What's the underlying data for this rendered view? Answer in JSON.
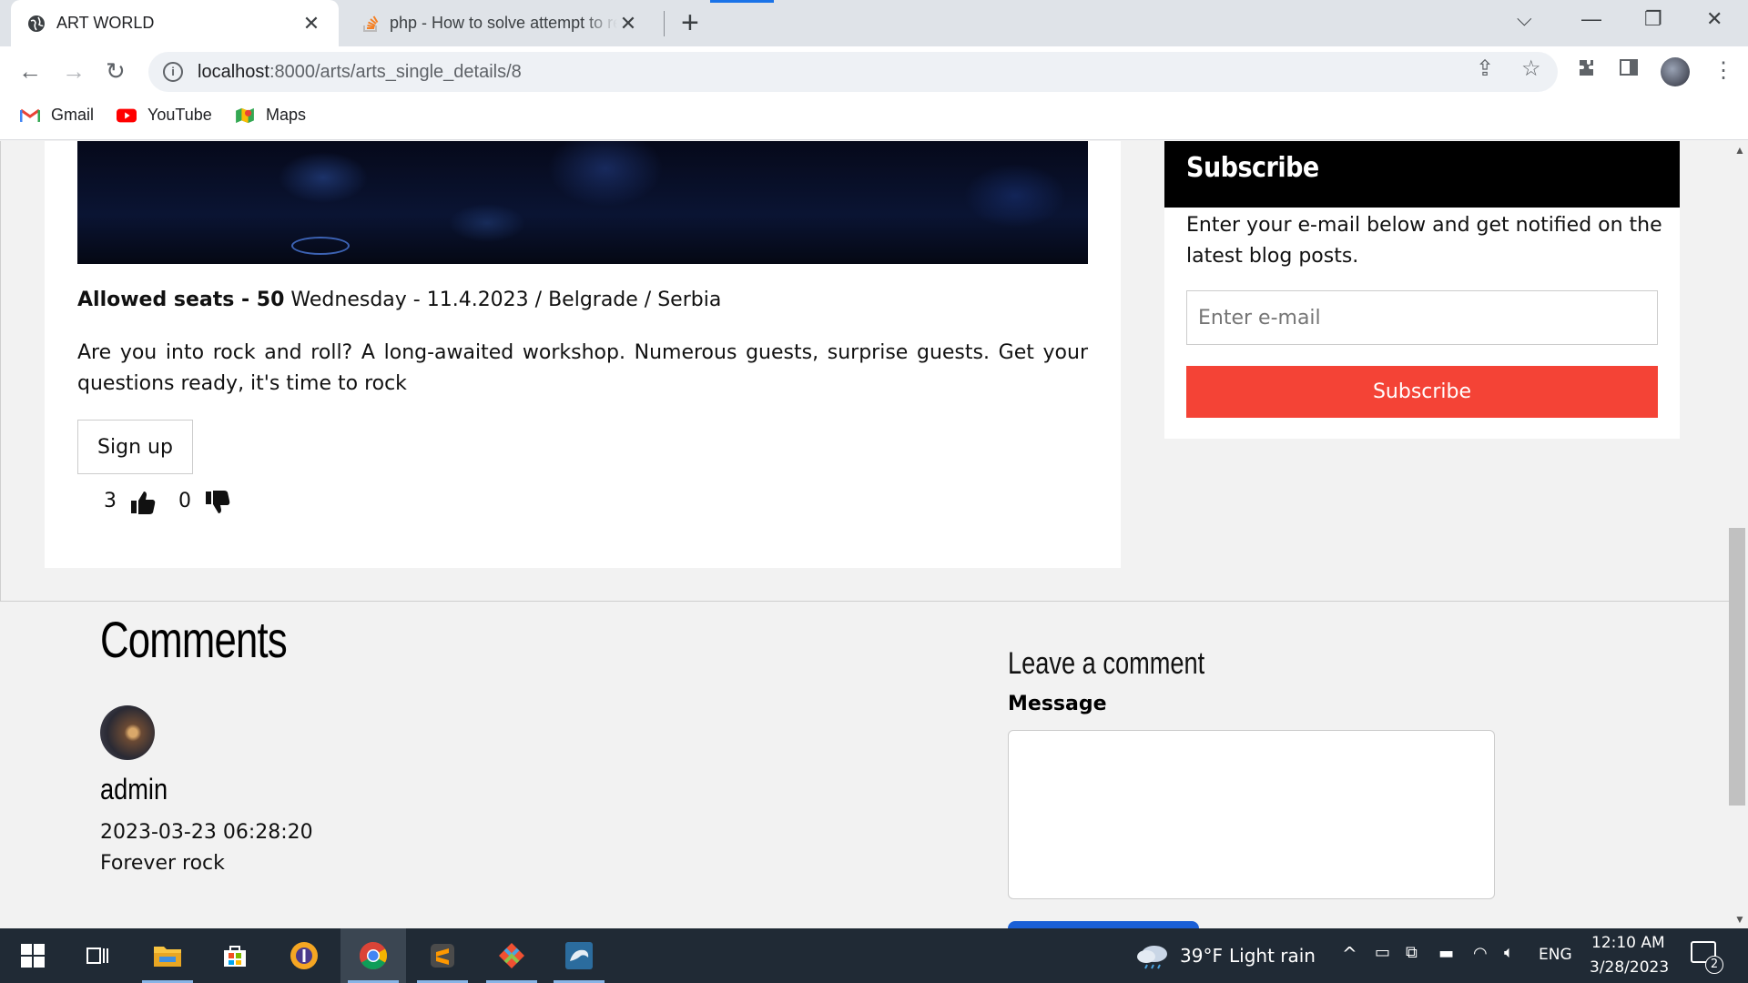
{
  "browser": {
    "tabs": [
      {
        "title": "ART WORLD",
        "active": true
      },
      {
        "title": "php - How to solve attempt to re",
        "active": false
      }
    ],
    "new_tab": "+",
    "address": {
      "host": "localhost",
      "path": ":8000/arts/arts_single_details/8"
    },
    "bookmarks": [
      {
        "label": "Gmail",
        "icon": "gmail-icon"
      },
      {
        "label": "YouTube",
        "icon": "youtube-icon"
      },
      {
        "label": "Maps",
        "icon": "maps-icon"
      }
    ]
  },
  "event": {
    "seats_label": "Allowed seats - 50",
    "when_where": " Wednesday - 11.4.2023 / Belgrade / Serbia",
    "description": "Are you into rock and roll? A long-awaited workshop. Numerous guests, surprise guests. Get your questions ready, it's time to rock",
    "signup_label": "Sign up",
    "likes": "3",
    "dislikes": "0"
  },
  "subscribe": {
    "title": "Subscribe",
    "text": "Enter your e-mail below and get notified on the latest blog posts.",
    "placeholder": "Enter e-mail",
    "button": "Subscribe"
  },
  "comments": {
    "title": "Comments",
    "items": [
      {
        "user": "admin",
        "date": "2023-03-23 06:28:20",
        "text": "Forever rock"
      }
    ]
  },
  "leave_comment": {
    "title": "Leave a comment",
    "message_label": "Message"
  },
  "taskbar": {
    "weather_temp": "39°F",
    "weather_desc": "Light rain",
    "lang": "ENG",
    "time": "12:10 AM",
    "date": "3/28/2023",
    "notifications": "2"
  },
  "colors": {
    "accent_red": "#f44336",
    "header_black": "#000000",
    "chrome_blue": "#1a73e8"
  }
}
